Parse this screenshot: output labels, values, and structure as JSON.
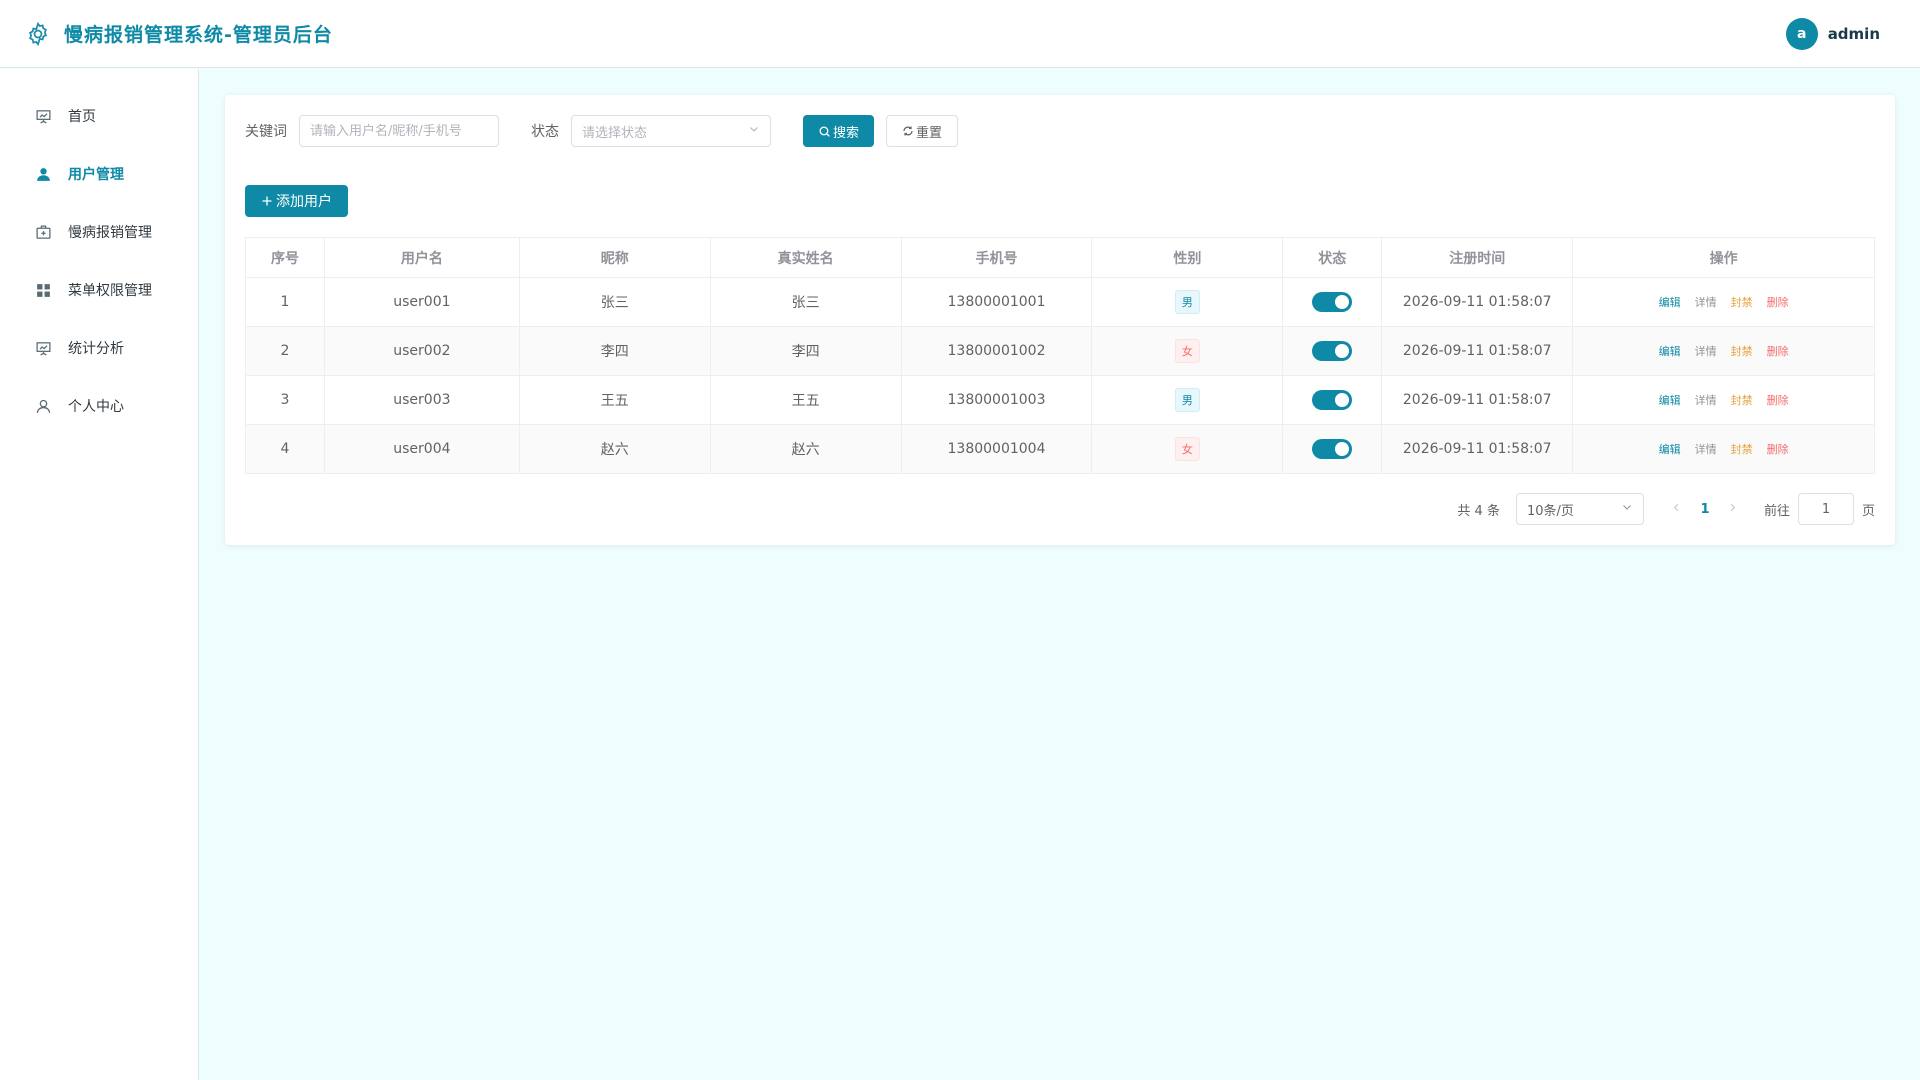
{
  "header": {
    "title": "慢病报销管理系统-管理员后台",
    "avatar_letter": "a",
    "username": "admin",
    "logo_icon": "gear-icon"
  },
  "sidebar": {
    "items": [
      {
        "label": "首页",
        "icon": "presentation-icon",
        "active": false
      },
      {
        "label": "用户管理",
        "icon": "user-icon",
        "active": true
      },
      {
        "label": "慢病报销管理",
        "icon": "first-aid-kit-icon",
        "active": false
      },
      {
        "label": "菜单权限管理",
        "icon": "grid-icon",
        "active": false
      },
      {
        "label": "统计分析",
        "icon": "chart-board-icon",
        "active": false
      },
      {
        "label": "个人中心",
        "icon": "person-outline-icon",
        "active": false
      }
    ]
  },
  "filter": {
    "keyword_label": "关键词",
    "keyword_placeholder": "请输入用户名/昵称/手机号",
    "status_label": "状态",
    "status_placeholder": "请选择状态",
    "search_label": "搜索",
    "reset_label": "重置"
  },
  "actions": {
    "add_label": "添加用户"
  },
  "table": {
    "columns": [
      "序号",
      "用户名",
      "昵称",
      "真实姓名",
      "手机号",
      "性别",
      "状态",
      "注册时间",
      "操作"
    ],
    "rows": [
      {
        "index": "1",
        "username": "user001",
        "nickname": "张三",
        "realname": "张三",
        "phone": "13800001001",
        "gender": "男",
        "enabled": true,
        "registered": "2026-09-11 01:58:07"
      },
      {
        "index": "2",
        "username": "user002",
        "nickname": "李四",
        "realname": "李四",
        "phone": "13800001002",
        "gender": "女",
        "enabled": true,
        "registered": "2026-09-11 01:58:07"
      },
      {
        "index": "3",
        "username": "user003",
        "nickname": "王五",
        "realname": "王五",
        "phone": "13800001003",
        "gender": "男",
        "enabled": true,
        "registered": "2026-09-11 01:58:07"
      },
      {
        "index": "4",
        "username": "user004",
        "nickname": "赵六",
        "realname": "赵六",
        "phone": "13800001004",
        "gender": "女",
        "enabled": true,
        "registered": "2026-09-11 01:58:07"
      }
    ],
    "row_actions": {
      "edit": "编辑",
      "detail": "详情",
      "ban": "封禁",
      "delete": "删除"
    }
  },
  "pagination": {
    "total_text": "共 4 条",
    "page_size": "10条/页",
    "current_page": "1",
    "goto_label": "前往",
    "goto_value": "1",
    "page_suffix": "页"
  },
  "colors": {
    "primary": "#0f8aa6",
    "background": "#eefdfd",
    "danger": "#f56c6c",
    "warning": "#e6a23c"
  }
}
